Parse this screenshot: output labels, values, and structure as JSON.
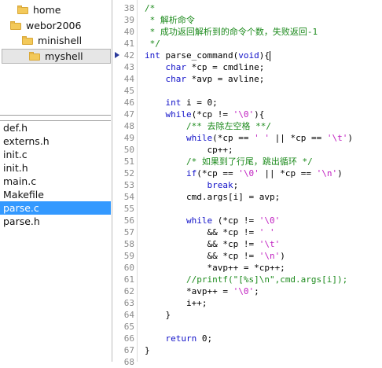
{
  "tree": [
    {
      "label": "home",
      "selected": false
    },
    {
      "label": "webor2006",
      "selected": false
    },
    {
      "label": "minishell",
      "selected": false
    },
    {
      "label": "myshell",
      "selected": true
    }
  ],
  "files": [
    {
      "label": "def.h",
      "selected": false
    },
    {
      "label": "externs.h",
      "selected": false
    },
    {
      "label": "init.c",
      "selected": false
    },
    {
      "label": "init.h",
      "selected": false
    },
    {
      "label": "main.c",
      "selected": false
    },
    {
      "label": "Makefile",
      "selected": false
    },
    {
      "label": "parse.c",
      "selected": true
    },
    {
      "label": "parse.h",
      "selected": false
    }
  ],
  "editor": {
    "current_line": 42,
    "lines": [
      {
        "n": "38",
        "segs": [
          [
            "/*",
            "cm"
          ]
        ]
      },
      {
        "n": "39",
        "segs": [
          [
            " * 解析命令",
            "cm"
          ]
        ]
      },
      {
        "n": "40",
        "segs": [
          [
            " * 成功返回解析到的命令个数，失败返回-1",
            "cm"
          ]
        ]
      },
      {
        "n": "41",
        "segs": [
          [
            " */",
            "cm"
          ]
        ]
      },
      {
        "n": "42",
        "segs": [
          [
            "int",
            "kw"
          ],
          [
            " parse_command(",
            ""
          ],
          [
            "void",
            "kw"
          ],
          [
            "){",
            ""
          ]
        ],
        "caret": true
      },
      {
        "n": "43",
        "segs": [
          [
            "    ",
            ""
          ],
          [
            "char",
            "kw"
          ],
          [
            " *cp = cmdline;",
            ""
          ]
        ]
      },
      {
        "n": "44",
        "segs": [
          [
            "    ",
            ""
          ],
          [
            "char",
            "kw"
          ],
          [
            " *avp = avline;",
            ""
          ]
        ]
      },
      {
        "n": "45",
        "segs": []
      },
      {
        "n": "46",
        "segs": [
          [
            "    ",
            ""
          ],
          [
            "int",
            "kw"
          ],
          [
            " i = 0;",
            ""
          ]
        ]
      },
      {
        "n": "47",
        "segs": [
          [
            "    ",
            ""
          ],
          [
            "while",
            "kw"
          ],
          [
            "(*cp != ",
            ""
          ],
          [
            "'\\0'",
            "st"
          ],
          [
            "){",
            ""
          ]
        ]
      },
      {
        "n": "48",
        "segs": [
          [
            "        ",
            ""
          ],
          [
            "/** 去除左空格 **/",
            "cm"
          ]
        ]
      },
      {
        "n": "49",
        "segs": [
          [
            "        ",
            ""
          ],
          [
            "while",
            "kw"
          ],
          [
            "(*cp == ",
            ""
          ],
          [
            "' '",
            "st"
          ],
          [
            " || *cp == ",
            ""
          ],
          [
            "'\\t'",
            "st"
          ],
          [
            ")",
            ""
          ]
        ]
      },
      {
        "n": "50",
        "segs": [
          [
            "            cp++;",
            ""
          ]
        ]
      },
      {
        "n": "51",
        "segs": [
          [
            "        ",
            ""
          ],
          [
            "/* 如果到了行尾，跳出循环 */",
            "cm"
          ]
        ]
      },
      {
        "n": "52",
        "segs": [
          [
            "        ",
            ""
          ],
          [
            "if",
            "kw"
          ],
          [
            "(*cp == ",
            ""
          ],
          [
            "'\\0'",
            "st"
          ],
          [
            " || *cp == ",
            ""
          ],
          [
            "'\\n'",
            "st"
          ],
          [
            ")",
            ""
          ]
        ]
      },
      {
        "n": "53",
        "segs": [
          [
            "            ",
            ""
          ],
          [
            "break",
            "kw"
          ],
          [
            ";",
            ""
          ]
        ]
      },
      {
        "n": "54",
        "segs": [
          [
            "        cmd.args[i] = avp;",
            ""
          ]
        ]
      },
      {
        "n": "55",
        "segs": []
      },
      {
        "n": "56",
        "segs": [
          [
            "        ",
            ""
          ],
          [
            "while",
            "kw"
          ],
          [
            " (*cp != ",
            ""
          ],
          [
            "'\\0'",
            "st"
          ]
        ]
      },
      {
        "n": "57",
        "segs": [
          [
            "            && *cp != ",
            ""
          ],
          [
            "' '",
            "st"
          ]
        ]
      },
      {
        "n": "58",
        "segs": [
          [
            "            && *cp != ",
            ""
          ],
          [
            "'\\t'",
            "st"
          ]
        ]
      },
      {
        "n": "59",
        "segs": [
          [
            "            && *cp != ",
            ""
          ],
          [
            "'\\n'",
            "st"
          ],
          [
            ")",
            ""
          ]
        ]
      },
      {
        "n": "60",
        "segs": [
          [
            "            *avp++ = *cp++;",
            ""
          ]
        ]
      },
      {
        "n": "61",
        "segs": [
          [
            "        ",
            ""
          ],
          [
            "//printf(\"[%s]\\n\",cmd.args[i]);",
            "cm"
          ]
        ]
      },
      {
        "n": "62",
        "segs": [
          [
            "        *avp++ = ",
            ""
          ],
          [
            "'\\0'",
            "st"
          ],
          [
            ";",
            ""
          ]
        ]
      },
      {
        "n": "63",
        "segs": [
          [
            "        i++;",
            ""
          ]
        ]
      },
      {
        "n": "64",
        "segs": [
          [
            "    }",
            ""
          ]
        ]
      },
      {
        "n": "65",
        "segs": []
      },
      {
        "n": "66",
        "segs": [
          [
            "    ",
            ""
          ],
          [
            "return",
            "kw"
          ],
          [
            " 0;",
            ""
          ]
        ]
      },
      {
        "n": "67",
        "segs": [
          [
            "}",
            ""
          ]
        ]
      },
      {
        "n": "68",
        "segs": []
      }
    ]
  },
  "colors": {
    "comment": "#1c8a1c",
    "keyword": "#1010c8",
    "string": "#c01fc0",
    "selection": "#3399ff",
    "line_number": "#8a8a8a"
  }
}
